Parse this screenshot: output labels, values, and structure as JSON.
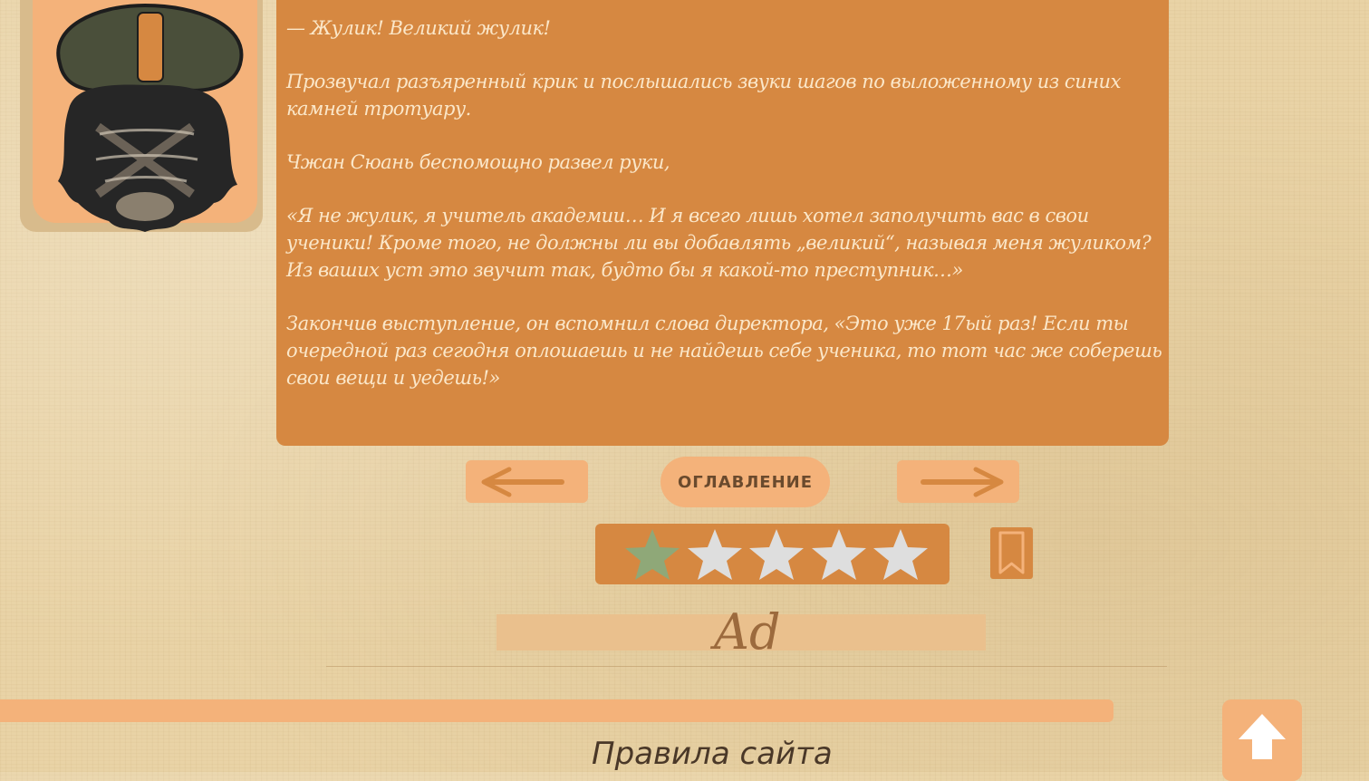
{
  "logo": {
    "icon": "bearded-character-logo-icon"
  },
  "chapter_text": {
    "paragraphs": [
      "— Жулик! Великий жулик!",
      "Прозвучал разъяренный крик и послышались звуки шагов по выложенному из синих камней тротуару.",
      "Чжан Сюань беспомощно развел руки,",
      "«Я не жулик, я учитель академии… И я всего лишь хотел заполучить вас в свои ученики! Кроме того, не должны ли вы добавлять „великий“, называя меня жуликом? Из ваших уст это звучит так, будто бы я какой-то преступник…»",
      "Закончив выступление, он вспомнил слова директора, «Это уже 17ый раз! Если ты очередной раз сегодня оплошаешь и не найдешь себе ученика, то тот час же соберешь свои вещи и уедешь!»"
    ]
  },
  "navigation": {
    "prev_icon": "arrow-left-icon",
    "next_icon": "arrow-right-icon",
    "toc_label": "ОГЛАВЛЕНИЕ"
  },
  "rating": {
    "max": 5,
    "value": 1,
    "active_color": "#8fa878",
    "inactive_color": "#dedede"
  },
  "bookmark": {
    "icon": "bookmark-icon"
  },
  "ad": {
    "label": "Ad"
  },
  "footer": {
    "title": "Правила сайта",
    "scroll_top_icon": "arrow-up-icon"
  },
  "colors": {
    "panel": "#d68841",
    "button": "#f4b27a",
    "text_light": "#fbe7c9",
    "background": "#e9d3a6"
  }
}
